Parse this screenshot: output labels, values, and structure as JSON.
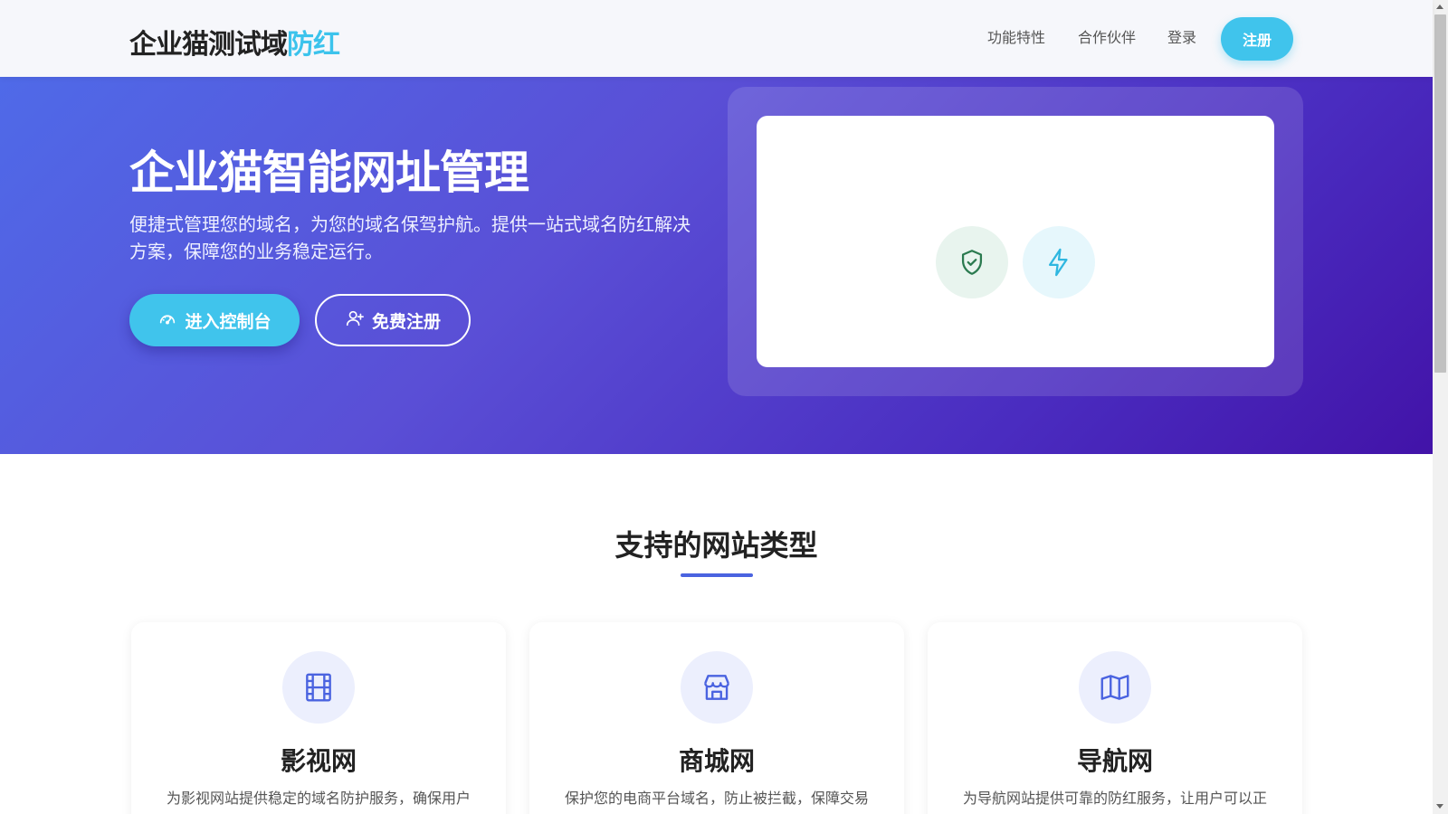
{
  "header": {
    "logo_main": "企业猫测试域",
    "logo_accent": "防红",
    "nav": [
      {
        "label": "功能特性"
      },
      {
        "label": "合作伙伴"
      },
      {
        "label": "登录"
      }
    ],
    "register_label": "注册"
  },
  "hero": {
    "title": "企业猫智能网址管理",
    "description": "便捷式管理您的域名，为您的域名保驾护航。提供一站式域名防红解决方案，保障您的业务稳定运行。",
    "primary_button": {
      "label": "进入控制台",
      "icon": "dashboard-icon"
    },
    "outline_button": {
      "label": "免费注册",
      "icon": "user-plus-icon"
    },
    "card_icons": [
      "shield-check-icon",
      "lightning-icon"
    ]
  },
  "section": {
    "title": "支持的网站类型",
    "cards": [
      {
        "icon": "film-icon",
        "title": "影视网",
        "desc": "为影视网站提供稳定的域名防护服务，确保用户"
      },
      {
        "icon": "store-icon",
        "title": "商城网",
        "desc": "保护您的电商平台域名，防止被拦截，保障交易"
      },
      {
        "icon": "map-icon",
        "title": "导航网",
        "desc": "为导航网站提供可靠的防红服务，让用户可以正"
      }
    ]
  },
  "colors": {
    "accent": "#40c4ec",
    "primary": "#4a63e0",
    "hero_gradient_start": "#4f6ae8",
    "hero_gradient_end": "#4213a8"
  }
}
